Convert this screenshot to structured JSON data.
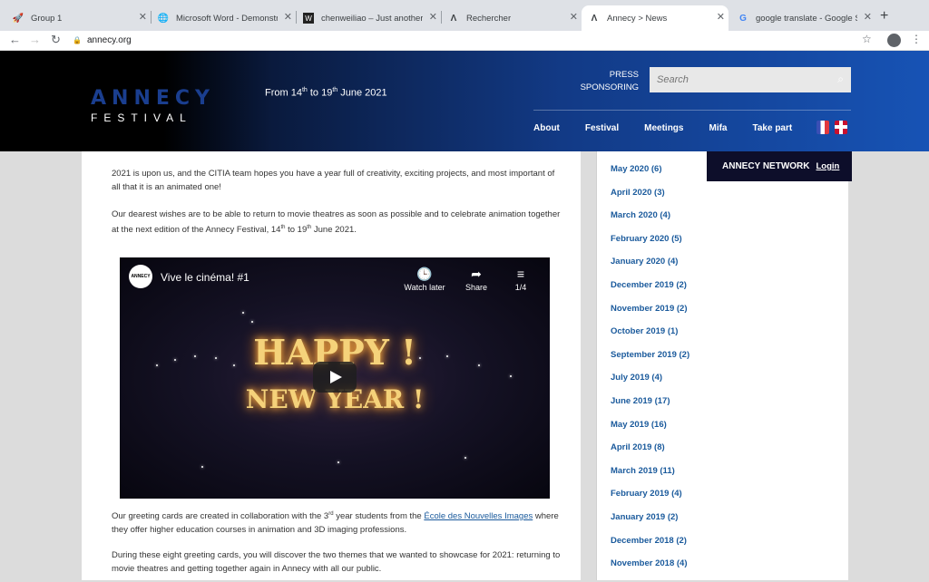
{
  "browser": {
    "tabs": [
      {
        "title": "Group 1",
        "favicon": "rocket-icon"
      },
      {
        "title": "Microsoft Word - Demonstra",
        "favicon": "globe-icon"
      },
      {
        "title": "chenweiliao – Just another",
        "favicon": "wordpress-icon"
      },
      {
        "title": "Rechercher",
        "favicon": "annecy-icon"
      },
      {
        "title": "Annecy > News",
        "favicon": "annecy-icon",
        "active": true
      },
      {
        "title": "google translate - Google Se",
        "favicon": "google-icon"
      }
    ],
    "url": "annecy.org"
  },
  "header": {
    "logo_top": "ANNECY",
    "logo_bottom": "FESTIVAL",
    "dates_prefix": "From 14",
    "dates_sup1": "th",
    "dates_mid": " to 19",
    "dates_sup2": "th",
    "dates_suffix": " June 2021",
    "press": "PRESS",
    "sponsoring": "SPONSORING",
    "search_placeholder": "Search",
    "nav": [
      "About",
      "Festival",
      "Meetings",
      "Mifa",
      "Take part"
    ]
  },
  "network": {
    "label": "ANNECY NETWORK",
    "login": "Login"
  },
  "content": {
    "p1": "2021 is upon us, and the CITIA team hopes you have a year full of creativity, exciting projects, and most important of all that it is an animated one!",
    "p2_a": "Our dearest wishes are to be able to return to movie theatres as soon as possible and to celebrate animation together at the next edition of the Annecy Festival, 14",
    "p2_sup1": "th",
    "p2_b": " to 19",
    "p2_sup2": "th",
    "p2_c": " June 2021.",
    "video": {
      "channel_logo": "ANNECY",
      "title": "Vive le cinéma! #1",
      "watch_later": "Watch later",
      "share": "Share",
      "playlist": "1/4",
      "happy": "HAPPY !",
      "new_year": "NEW YEAR !"
    },
    "p3_a": "Our greeting cards are created in collaboration with the 3",
    "p3_sup": "rd",
    "p3_b": " year students from the ",
    "p3_link": "École des Nouvelles Images",
    "p3_c": " where they offer higher education courses in animation and 3D imaging professions.",
    "p4": "During these eight greeting cards, you will discover the two themes that we wanted to showcase for 2021: returning to movie theatres and getting together again in Annecy with all our public."
  },
  "archive": [
    "May 2020 (6)",
    "April 2020 (3)",
    "March 2020 (4)",
    "February 2020 (5)",
    "January 2020 (4)",
    "December 2019 (2)",
    "November 2019 (2)",
    "October 2019 (1)",
    "September 2019 (2)",
    "July 2019 (4)",
    "June 2019 (17)",
    "May 2019 (16)",
    "April 2019 (8)",
    "March 2019 (11)",
    "February 2019 (4)",
    "January 2019 (2)",
    "December 2018 (2)",
    "November 2018 (4)"
  ]
}
